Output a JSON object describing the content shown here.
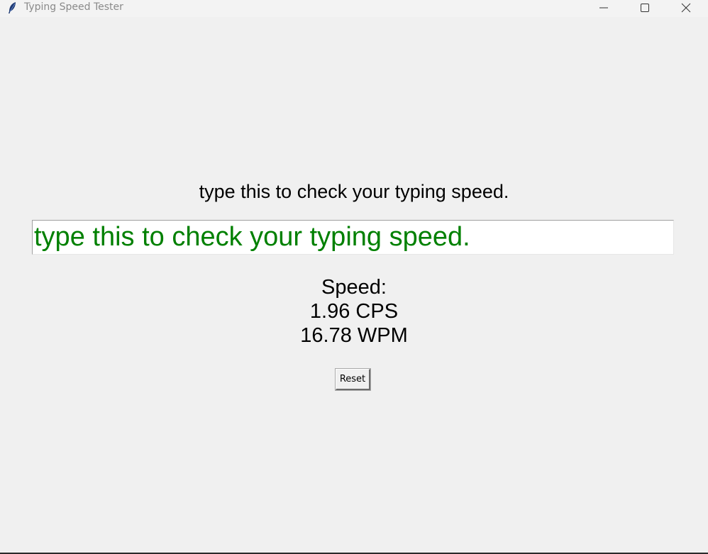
{
  "window": {
    "title": "Typing Speed Tester",
    "icon": "feather-icon"
  },
  "controls": {
    "minimize_icon": "minimize-icon",
    "maximize_icon": "maximize-icon",
    "close_icon": "close-icon"
  },
  "main": {
    "prompt_text": "type this to check your typing speed.",
    "entry_value": "type this to check your typing speed.",
    "speed_label": "Speed:",
    "cps_text": "1.96 CPS",
    "wpm_text": "16.78 WPM",
    "reset_label": "Reset"
  },
  "colors": {
    "background": "#f0f0f0",
    "entry_text": "#008000",
    "entry_bg": "#ffffff"
  }
}
